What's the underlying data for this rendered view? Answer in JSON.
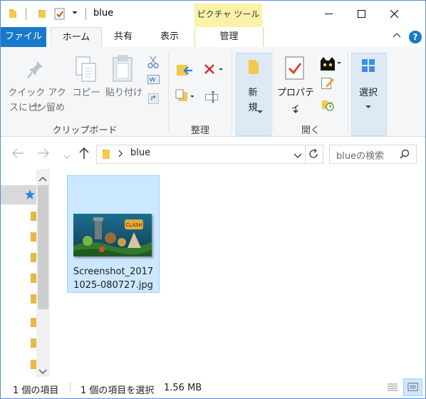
{
  "title_bar": {
    "title": "blue",
    "context_tab_label": "ピクチャ ツール"
  },
  "tabs": [
    {
      "label": "ファイル"
    },
    {
      "label": "ホーム"
    },
    {
      "label": "共有"
    },
    {
      "label": "表示"
    },
    {
      "label": "管理"
    }
  ],
  "ribbon": {
    "clipboard": {
      "group_label": "クリップボード",
      "quick_access_line1": "クイック アクセ",
      "quick_access_line2": "スにピン留め",
      "copy": "コピー",
      "paste": "貼り付け"
    },
    "organize": {
      "group_label": "整理"
    },
    "new": {
      "group_label": "",
      "new_line1": "新",
      "new_line2": "規"
    },
    "open": {
      "group_label": "開く",
      "properties": "プロパティ"
    },
    "select": {
      "label": "選択"
    }
  },
  "address_bar": {
    "path_segment": "blue",
    "search_placeholder": "blueの検索"
  },
  "files": [
    {
      "name_line1": "Screenshot_2017",
      "name_line2": "1025-080727.jpg",
      "selected": true
    }
  ],
  "status_bar": {
    "item_count": "1 個の項目",
    "selection_info": "1 個の項目を選択",
    "size": "1.56 MB"
  },
  "colors": {
    "accent": "#1979ca",
    "selection": "#cce8ff",
    "context_tab": "#f9f2a7",
    "folder": "#e8b942"
  }
}
